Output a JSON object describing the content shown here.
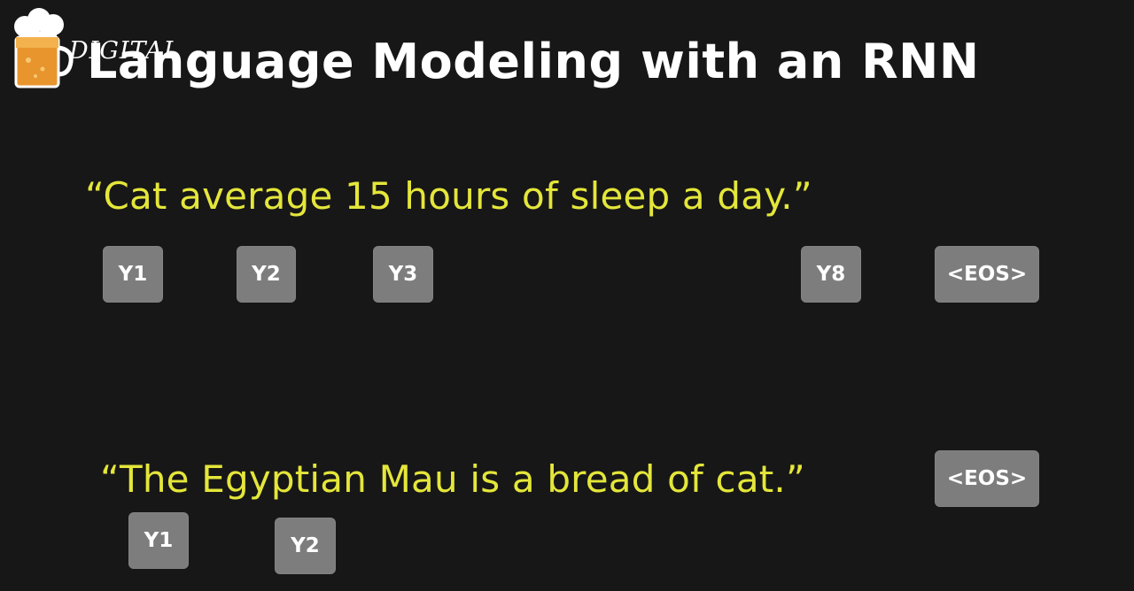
{
  "slide": {
    "title": "Language Modeling with an RNN",
    "logo": {
      "text": "DIGITAL"
    },
    "sentence_1": {
      "text": "“Cat average 15 hours of sleep a day.”",
      "tokens": [
        "Y1",
        "Y2",
        "Y3",
        "Y8",
        "<EOS>"
      ]
    },
    "sentence_2": {
      "text": "“The Egyptian Mau is a bread of cat.”",
      "tokens": [
        "<EOS>",
        "Y1",
        "Y2"
      ]
    }
  },
  "colors": {
    "background": "#171717",
    "title": "#ffffff",
    "sentence": "#e4e63a",
    "token_box": "#7d7d7d",
    "token_text": "#ffffff"
  }
}
